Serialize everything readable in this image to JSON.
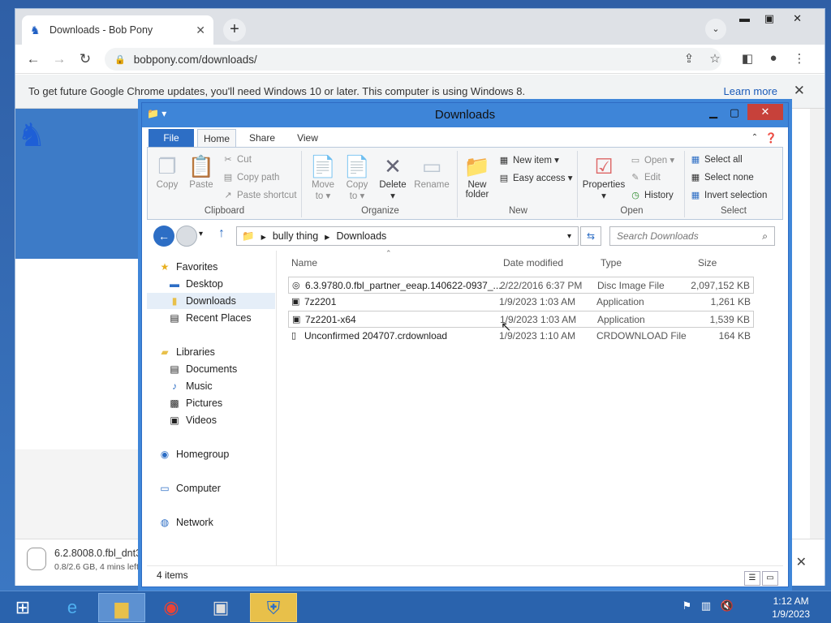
{
  "chrome": {
    "tab_title": "Downloads - Bob Pony",
    "url": "bobpony.com/downloads/",
    "infobar_text": "To get future Google Chrome updates, you'll need Windows 10 or later. This computer is using Windows 8.",
    "infobar_link": "Learn more",
    "download": {
      "name": "6.2.8008.0.fbl_dnt3",
      "status": "0.8/2.6 GB, 4 mins left"
    }
  },
  "explorer": {
    "title": "Downloads",
    "ribbon_tabs": [
      "File",
      "Home",
      "Share",
      "View"
    ],
    "clipboard": {
      "copy": "Copy",
      "paste": "Paste",
      "cut": "Cut",
      "copy_path": "Copy path",
      "paste_shortcut": "Paste shortcut",
      "group": "Clipboard"
    },
    "organize": {
      "move_to": "Move",
      "move_to2": "to",
      "copy_to": "Copy",
      "copy_to2": "to",
      "delete": "Delete",
      "rename": "Rename",
      "group": "Organize"
    },
    "new": {
      "new_folder": "New",
      "new_folder2": "folder",
      "new_item": "New item",
      "easy_access": "Easy access",
      "group": "New"
    },
    "open": {
      "properties": "Properties",
      "open": "Open",
      "edit": "Edit",
      "history": "History",
      "group": "Open"
    },
    "select": {
      "select_all": "Select all",
      "select_none": "Select none",
      "invert": "Invert selection",
      "group": "Select"
    },
    "path": [
      "bully thing",
      "Downloads"
    ],
    "search_placeholder": "Search Downloads",
    "nav": {
      "favorites": "Favorites",
      "desktop": "Desktop",
      "downloads": "Downloads",
      "recent": "Recent Places",
      "libraries": "Libraries",
      "documents": "Documents",
      "music": "Music",
      "pictures": "Pictures",
      "videos": "Videos",
      "homegroup": "Homegroup",
      "computer": "Computer",
      "network": "Network"
    },
    "columns": [
      "Name",
      "Date modified",
      "Type",
      "Size"
    ],
    "files": [
      {
        "name": "6.3.9780.0.fbl_partner_eeap.140622-0937_...",
        "date": "2/22/2016 6:37 PM",
        "type": "Disc Image File",
        "size": "2,097,152 KB"
      },
      {
        "name": "7z2201",
        "date": "1/9/2023 1:03 AM",
        "type": "Application",
        "size": "1,261 KB"
      },
      {
        "name": "7z2201-x64",
        "date": "1/9/2023 1:03 AM",
        "type": "Application",
        "size": "1,539 KB"
      },
      {
        "name": "Unconfirmed 204707.crdownload",
        "date": "1/9/2023 1:10 AM",
        "type": "CRDOWNLOAD File",
        "size": "164 KB"
      }
    ],
    "status": "4 items"
  },
  "taskbar": {
    "time": "1:12 AM",
    "date": "1/9/2023"
  }
}
